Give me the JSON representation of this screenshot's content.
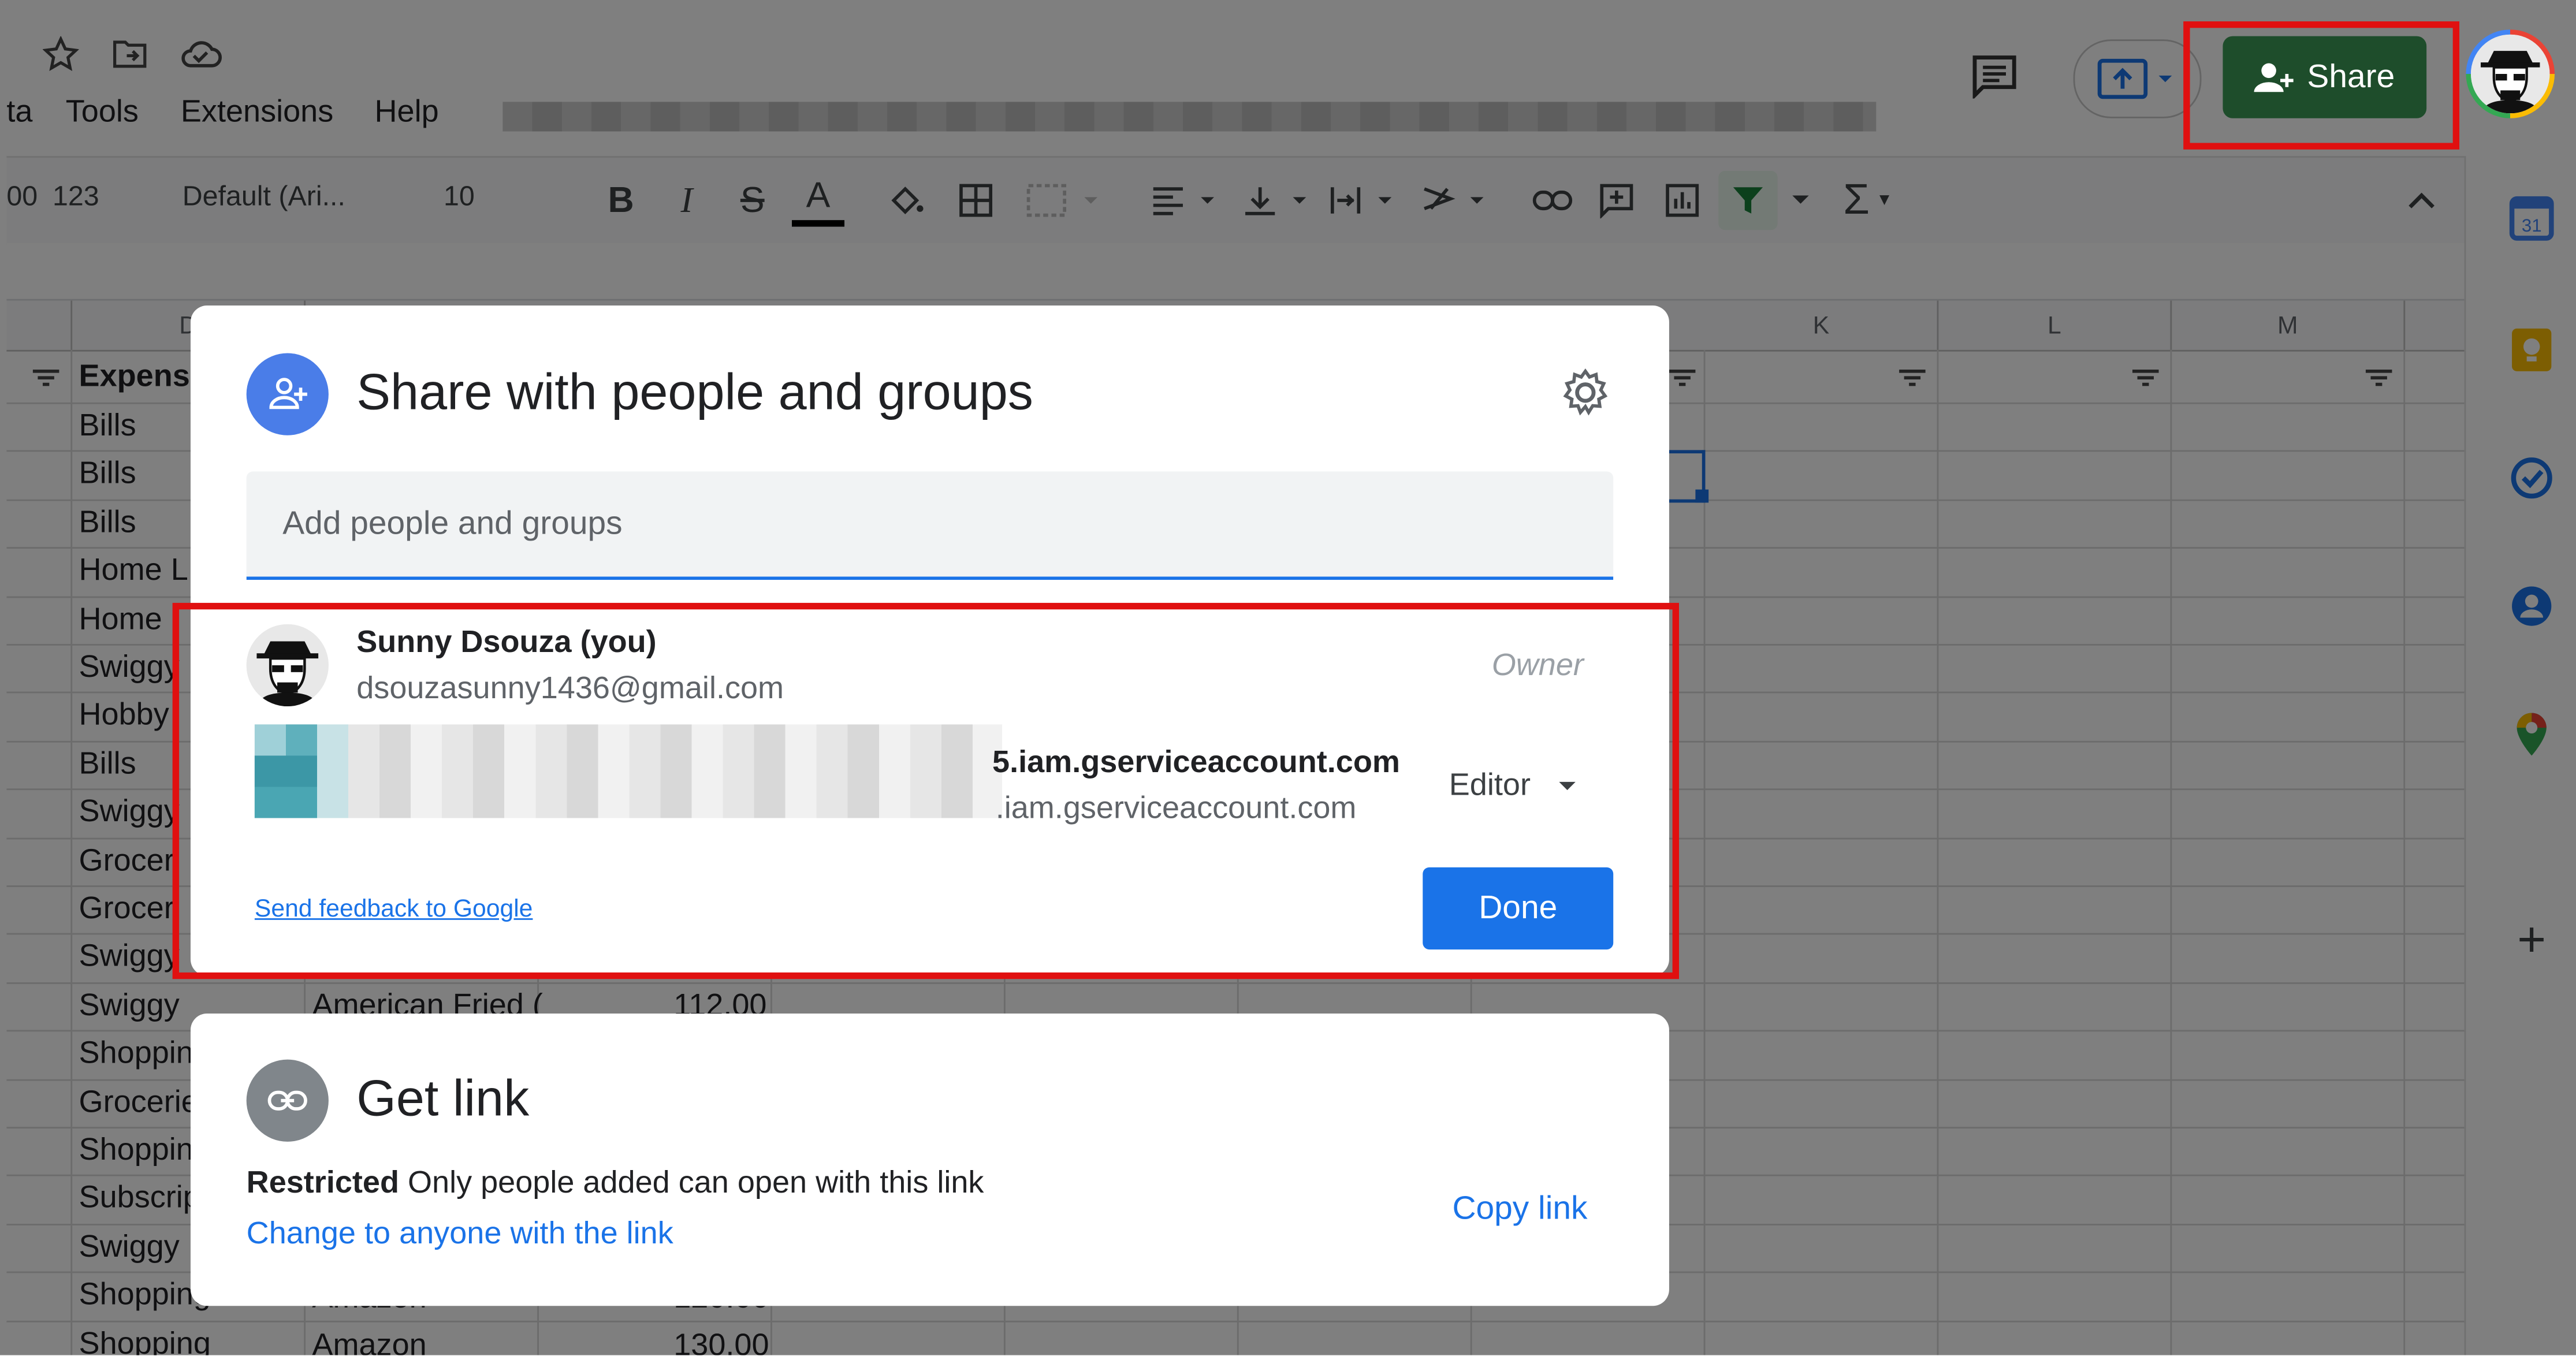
{
  "menu": {
    "items": [
      "ta",
      "Tools",
      "Extensions",
      "Help"
    ]
  },
  "toolbar": {
    "number_format_prefix": "00",
    "number_format": "123",
    "font": "Default (Ari...",
    "font_size": "10"
  },
  "header": {
    "share_label": "Share"
  },
  "grid": {
    "columns": [
      "D",
      "K",
      "L",
      "M"
    ],
    "column_d_header_fragment": "D",
    "first_col_header": "Expens",
    "rows": [
      "Bills",
      "Bills",
      "Bills",
      "Home L",
      "Home",
      "Swiggy",
      "Hobby",
      "Bills",
      "Swiggy",
      "Grocer",
      "Grocer",
      "Swiggy",
      "Swiggy",
      "Shoppin",
      "Grocerie",
      "Shoppin",
      "Subscrip",
      "Swiggy",
      "Shopping",
      "Shopping"
    ],
    "partial_row": {
      "col_b": "American Fried (",
      "col_c": "112.00"
    },
    "lower_rows": [
      {
        "col_b": "Amazon",
        "col_c": "120.00"
      },
      {
        "col_b": "Amazon",
        "col_c": "130.00"
      }
    ]
  },
  "share_dialog": {
    "title": "Share with people and groups",
    "input_placeholder": "Add people and groups",
    "people": [
      {
        "name": "Sunny Dsouza (you)",
        "email": "dsouzasunny1436@gmail.com",
        "role": "Owner"
      },
      {
        "name": "5.iam.gserviceaccount.com",
        "email": ".iam.gserviceaccount.com",
        "role": "Editor"
      }
    ],
    "feedback_link": "Send feedback to Google",
    "done_label": "Done"
  },
  "link_dialog": {
    "title": "Get link",
    "restriction": "Restricted",
    "restriction_desc": "Only people added can open with this link",
    "change_link": "Change to anyone with the link",
    "copy_link": "Copy link"
  },
  "colors": {
    "accent": "#1a73e8",
    "share_button": "#1e4d2b",
    "highlight": "#e01010"
  }
}
